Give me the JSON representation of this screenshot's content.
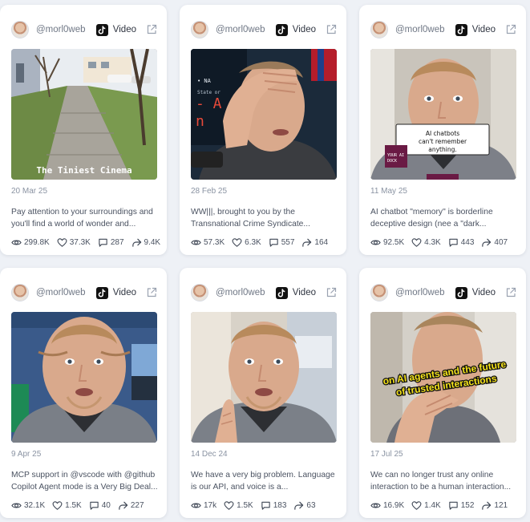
{
  "cards": [
    {
      "username": "@morl0web",
      "platform": "Video",
      "thumb_text": "The Tiniest Cinema",
      "date": "20 Mar 25",
      "caption": "Pay attention to your surroundings and you'll find a world of wonder and...",
      "views": "299.8K",
      "likes": "37.3K",
      "comments": "287",
      "shares": "9.4K"
    },
    {
      "username": "@morl0web",
      "platform": "Video",
      "thumb_text": "",
      "date": "28 Feb 25",
      "caption": "WW|||, brought to you by the Transnational Crime Syndicate...",
      "views": "57.3K",
      "likes": "6.3K",
      "comments": "557",
      "shares": "164"
    },
    {
      "username": "@morl0web",
      "platform": "Video",
      "thumb_text": "AI chatbots can't remember anything.",
      "date": "11 May 25",
      "caption": "AI chatbot \"memory\" is borderline deceptive design (nee a \"dark...",
      "views": "92.5K",
      "likes": "4.3K",
      "comments": "443",
      "shares": "407"
    },
    {
      "username": "@morl0web",
      "platform": "Video",
      "thumb_text": "",
      "date": "9 Apr 25",
      "caption": "MCP support in @vscode with @github Copilot Agent mode is a Very Big Deal...",
      "views": "32.1K",
      "likes": "1.5K",
      "comments": "40",
      "shares": "227"
    },
    {
      "username": "@morl0web",
      "platform": "Video",
      "thumb_text": "",
      "date": "14 Dec 24",
      "caption": "We have a very big problem. Language is our API, and voice is a...",
      "views": "17k",
      "likes": "1.5K",
      "comments": "183",
      "shares": "63"
    },
    {
      "username": "@morl0web",
      "platform": "Video",
      "thumb_text": "on AI agents and the future of trusted interactions",
      "date": "17 Jul 25",
      "caption": "We can no longer trust any online interaction to be a human interaction...",
      "views": "16.9K",
      "likes": "1.4K",
      "comments": "152",
      "shares": "121"
    }
  ]
}
